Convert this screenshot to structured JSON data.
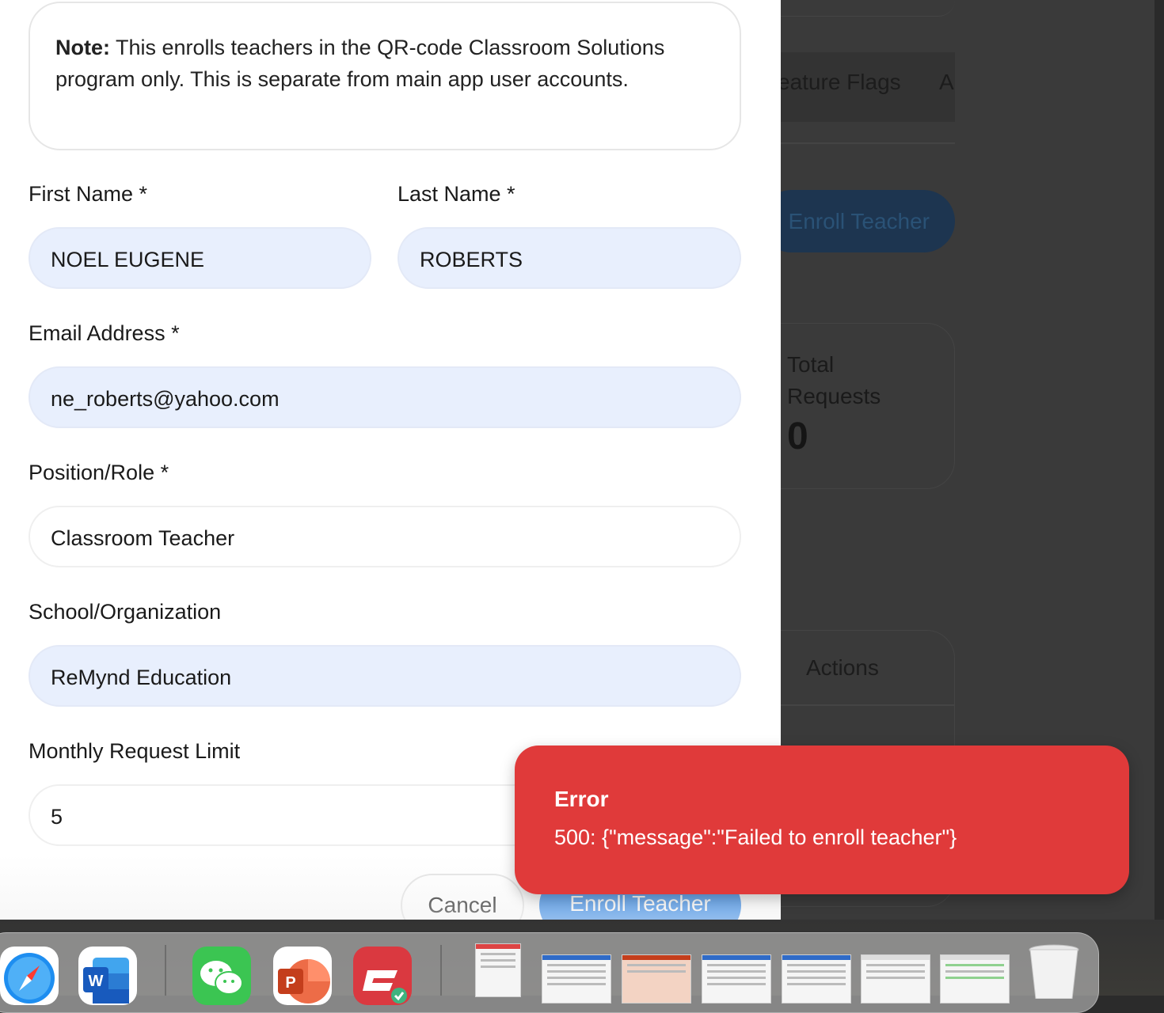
{
  "background_app": {
    "tabs": [
      "eature Flags",
      "A"
    ],
    "enroll_button_label": "Enroll Teacher",
    "stat_label": "Total Requests",
    "stat_value": "0",
    "table_header_actions": "Actions"
  },
  "modal": {
    "note_prefix": "Note:",
    "note_text": " This enrolls teachers in the QR-code Classroom Solutions program only. This is separate from main app user accounts.",
    "fields": {
      "first_name_label": "First Name *",
      "first_name_value": "NOEL EUGENE",
      "last_name_label": "Last Name *",
      "last_name_value": "ROBERTS",
      "email_label": "Email Address *",
      "email_value": "ne_roberts@yahoo.com",
      "position_label": "Position/Role *",
      "position_value": "Classroom Teacher",
      "school_label": "School/Organization",
      "school_value": "ReMynd Education",
      "limit_label": "Monthly Request Limit",
      "limit_value": "5"
    },
    "cancel_label": "Cancel",
    "submit_label": "Enroll Teacher"
  },
  "toast": {
    "title": "Error",
    "message": "500: {\"message\":\"Failed to enroll teacher\"}",
    "color": "#e03a3a"
  },
  "dock": {
    "apps": [
      "safari-icon",
      "word-icon",
      "wechat-icon",
      "powerpoint-icon",
      "expressvpn-icon",
      "trash-icon"
    ]
  }
}
